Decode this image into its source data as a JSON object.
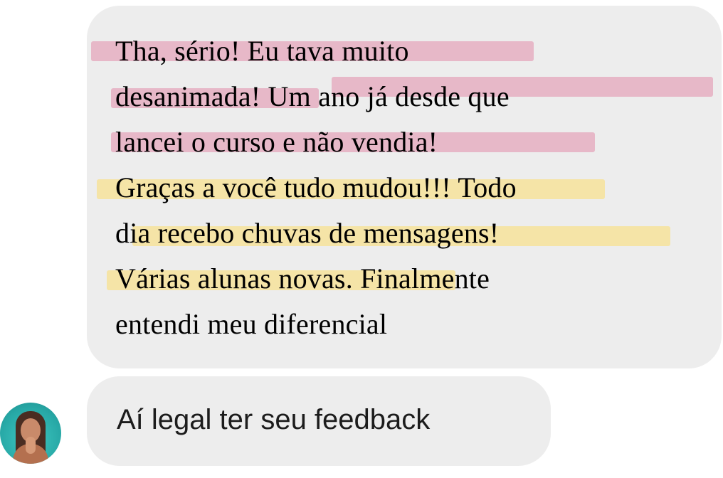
{
  "conversation": {
    "incoming_message": {
      "lines": [
        "Tha, sério! Eu tava muito",
        "desanimada! Um ano já desde que",
        "lancei o curso e não vendia!",
        "Graças a você tudo mudou!!! Todo",
        "dia recebo chuvas de mensagens!",
        "Várias alunas novas. Finalmente",
        "entendi meu diferencial"
      ],
      "highlight_colors": {
        "pink": "#e28caa",
        "yellow": "#fade78"
      }
    },
    "reply_message": {
      "text": "Aí legal ter seu feedback"
    },
    "bubble_color": "#ededed",
    "avatar": {
      "icon": "profile-photo-icon",
      "background_color": "#27a8a6"
    }
  }
}
